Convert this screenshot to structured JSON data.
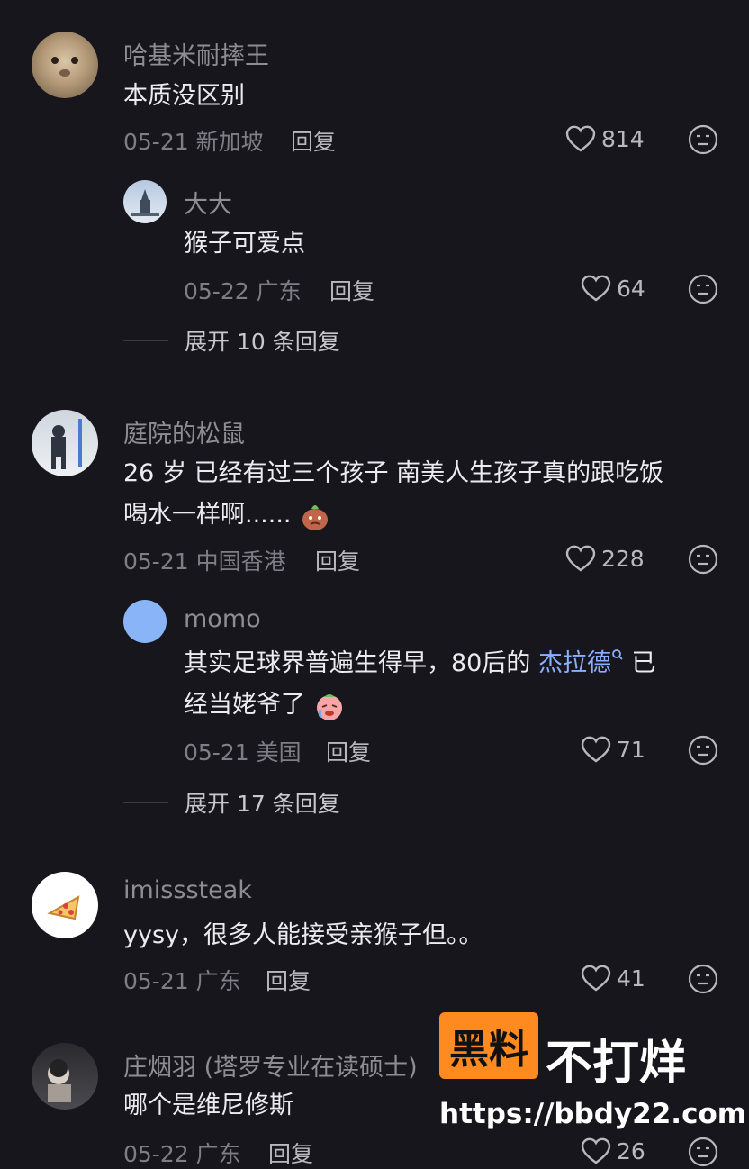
{
  "comments": [
    {
      "username": "哈基米耐摔王",
      "text": "本质没区别",
      "date": "05-21",
      "location": "新加坡",
      "reply_label": "回复",
      "likes": "814",
      "replies": [
        {
          "username": "大大",
          "text": "猴子可爱点",
          "date": "05-22",
          "location": "广东",
          "reply_label": "回复",
          "likes": "64"
        }
      ],
      "expand_label": "展开 10 条回复"
    },
    {
      "username": "庭院的松鼠",
      "text_line1": "26 岁 已经有过三个孩子 南美人生孩子真的跟吃饭",
      "text_line2": "喝水一样啊......",
      "date": "05-21",
      "location": "中国香港",
      "reply_label": "回复",
      "likes": "228",
      "replies": [
        {
          "username": "momo",
          "text_before": "其实足球界普遍生得早，80后的 ",
          "link": "杰拉德",
          "text_after": " 已",
          "text_line2": "经当姥爷了",
          "date": "05-21",
          "location": "美国",
          "reply_label": "回复",
          "likes": "71"
        }
      ],
      "expand_label": "展开 17 条回复"
    },
    {
      "username": "imisssteak",
      "text": "yysy，很多人能接受亲猴子但。。",
      "date": "05-21",
      "location": "广东",
      "reply_label": "回复",
      "likes": "41"
    },
    {
      "username": "庄烟羽 (塔罗专业在读硕士)",
      "text": "哪个是维尼修斯",
      "date": "05-22",
      "location": "广东",
      "reply_label": "回复",
      "likes": "26"
    }
  ],
  "watermark": {
    "box_text": "黑料",
    "text": "不打烊",
    "url": "https://bbdy22.com"
  },
  "colors": {
    "background": "#17161c",
    "link": "#8ab0ff",
    "watermark": "#ff8a1f"
  }
}
